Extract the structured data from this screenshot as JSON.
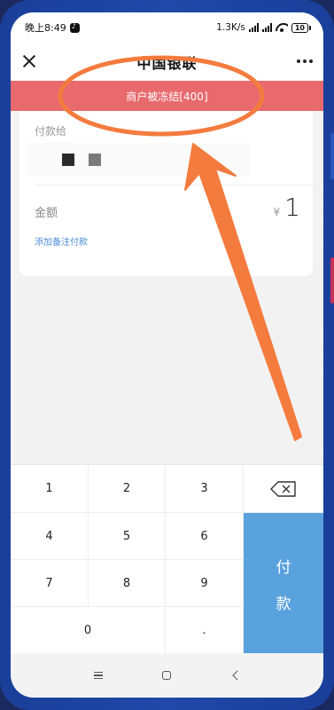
{
  "status_bar": {
    "time": "晚上8:49",
    "network_speed": "1.3K/s",
    "network_type": "4G",
    "battery": "10"
  },
  "app_bar": {
    "title": "中国银联",
    "close_icon": "close-icon",
    "more_icon": "more-icon"
  },
  "banner": {
    "message": "商户被冻结[400]",
    "color": "#e86a6d"
  },
  "payment": {
    "payee_label": "付款给",
    "amount_label": "金额",
    "currency_symbol": "¥",
    "amount": "1",
    "add_note": "添加备注付款"
  },
  "keypad": {
    "keys": [
      "1",
      "2",
      "3",
      "4",
      "5",
      "6",
      "7",
      "8",
      "9",
      "0",
      "."
    ],
    "backspace_icon": "backspace-icon",
    "pay_label_1": "付",
    "pay_label_2": "款",
    "pay_color": "#5aa2de"
  },
  "annotation": {
    "color": "#f47b3e"
  },
  "system_nav": {
    "menu_icon": "menu-icon",
    "home_icon": "home-icon",
    "back_icon": "back-icon"
  }
}
